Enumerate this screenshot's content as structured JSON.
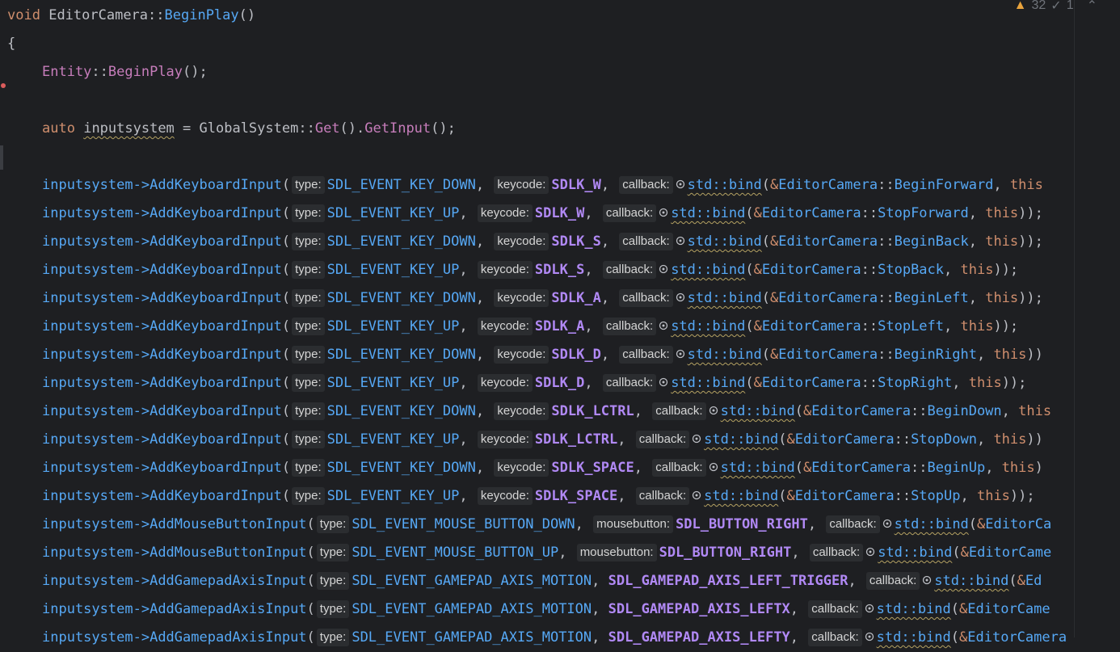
{
  "inspection": {
    "warnings_count": "32",
    "ok_count": "1"
  },
  "code": {
    "l1_void": "void",
    "l1_class": "EditorCamera",
    "l1_sep": "::",
    "l1_fn": "BeginPlay",
    "l1_paren": "()",
    "l2_brace": "{",
    "l3_base": "Entity",
    "l3_sep": "::",
    "l3_fn": "BeginPlay",
    "l3_rest": "();",
    "l5_auto": "auto",
    "l5_var": "inputsystem",
    "l5_eq": " = ",
    "l5_cls": "GlobalSystem",
    "l5_sep": "::",
    "l5_get": "Get",
    "l5_mid": "().",
    "l5_getinput": "GetInput",
    "l5_end": "();"
  },
  "hints": {
    "type": "type:",
    "keycode": "keycode:",
    "callback": "callback:",
    "mousebutton": "mousebutton:"
  },
  "calls": [
    {
      "method": "AddKeyboardInput",
      "event": "SDL_EVENT_KEY_DOWN",
      "key": "SDLK_W",
      "hint2": "keycode:",
      "target": "BeginForward",
      "tail": ", this"
    },
    {
      "method": "AddKeyboardInput",
      "event": "SDL_EVENT_KEY_UP",
      "key": "SDLK_W",
      "hint2": "keycode:",
      "target": "StopForward",
      "tail": ", this));"
    },
    {
      "method": "AddKeyboardInput",
      "event": "SDL_EVENT_KEY_DOWN",
      "key": "SDLK_S",
      "hint2": "keycode:",
      "target": "BeginBack",
      "tail": ", this));"
    },
    {
      "method": "AddKeyboardInput",
      "event": "SDL_EVENT_KEY_UP",
      "key": "SDLK_S",
      "hint2": "keycode:",
      "target": "StopBack",
      "tail": ", this));"
    },
    {
      "method": "AddKeyboardInput",
      "event": "SDL_EVENT_KEY_DOWN",
      "key": "SDLK_A",
      "hint2": "keycode:",
      "target": "BeginLeft",
      "tail": ", this));"
    },
    {
      "method": "AddKeyboardInput",
      "event": "SDL_EVENT_KEY_UP",
      "key": "SDLK_A",
      "hint2": "keycode:",
      "target": "StopLeft",
      "tail": ", this));"
    },
    {
      "method": "AddKeyboardInput",
      "event": "SDL_EVENT_KEY_DOWN",
      "key": "SDLK_D",
      "hint2": "keycode:",
      "target": "BeginRight",
      "tail": ", this))"
    },
    {
      "method": "AddKeyboardInput",
      "event": "SDL_EVENT_KEY_UP",
      "key": "SDLK_D",
      "hint2": "keycode:",
      "target": "StopRight",
      "tail": ", this));"
    },
    {
      "method": "AddKeyboardInput",
      "event": "SDL_EVENT_KEY_DOWN",
      "key": "SDLK_LCTRL",
      "hint2": "keycode:",
      "target": "BeginDown",
      "tail": ", this"
    },
    {
      "method": "AddKeyboardInput",
      "event": "SDL_EVENT_KEY_UP",
      "key": "SDLK_LCTRL",
      "hint2": "keycode:",
      "target": "StopDown",
      "tail": ", this))"
    },
    {
      "method": "AddKeyboardInput",
      "event": "SDL_EVENT_KEY_DOWN",
      "key": "SDLK_SPACE",
      "hint2": "keycode:",
      "target": "BeginUp",
      "tail": ", this)"
    },
    {
      "method": "AddKeyboardInput",
      "event": "SDL_EVENT_KEY_UP",
      "key": "SDLK_SPACE",
      "hint2": "keycode:",
      "target": "StopUp",
      "tail": ", this));"
    },
    {
      "method": "AddMouseButtonInput",
      "event": "SDL_EVENT_MOUSE_BUTTON_DOWN",
      "key": "SDL_BUTTON_RIGHT",
      "hint2": "mousebutton:",
      "target": "",
      "tail": ""
    },
    {
      "method": "AddMouseButtonInput",
      "event": "SDL_EVENT_MOUSE_BUTTON_UP",
      "key": "SDL_BUTTON_RIGHT",
      "hint2": "mousebutton:",
      "target": "",
      "tail": ""
    },
    {
      "method": "AddGamepadAxisInput",
      "event": "SDL_EVENT_GAMEPAD_AXIS_MOTION",
      "key": "SDL_GAMEPAD_AXIS_LEFT_TRIGGER",
      "hint2": "",
      "target": "",
      "tail": ""
    },
    {
      "method": "AddGamepadAxisInput",
      "event": "SDL_EVENT_GAMEPAD_AXIS_MOTION",
      "key": "SDL_GAMEPAD_AXIS_LEFTX",
      "hint2": "",
      "target": "",
      "tail": ""
    },
    {
      "method": "AddGamepadAxisInput",
      "event": "SDL_EVENT_GAMEPAD_AXIS_MOTION",
      "key": "SDL_GAMEPAD_AXIS_LEFTY",
      "hint2": "",
      "target": "",
      "tail": ""
    }
  ],
  "tokens": {
    "receiver": "inputsystem",
    "arrow": "->",
    "open": "(",
    "comma": ", ",
    "std": "std",
    "sep": "::",
    "bind": "bind",
    "amp": "&",
    "cls": "EditorCamera",
    "truncated_cls_1": "EditorCa",
    "truncated_cls_2": "EditorCame",
    "truncated_cls_3": "Ed",
    "truncated_cls_4": "EditorCame"
  }
}
